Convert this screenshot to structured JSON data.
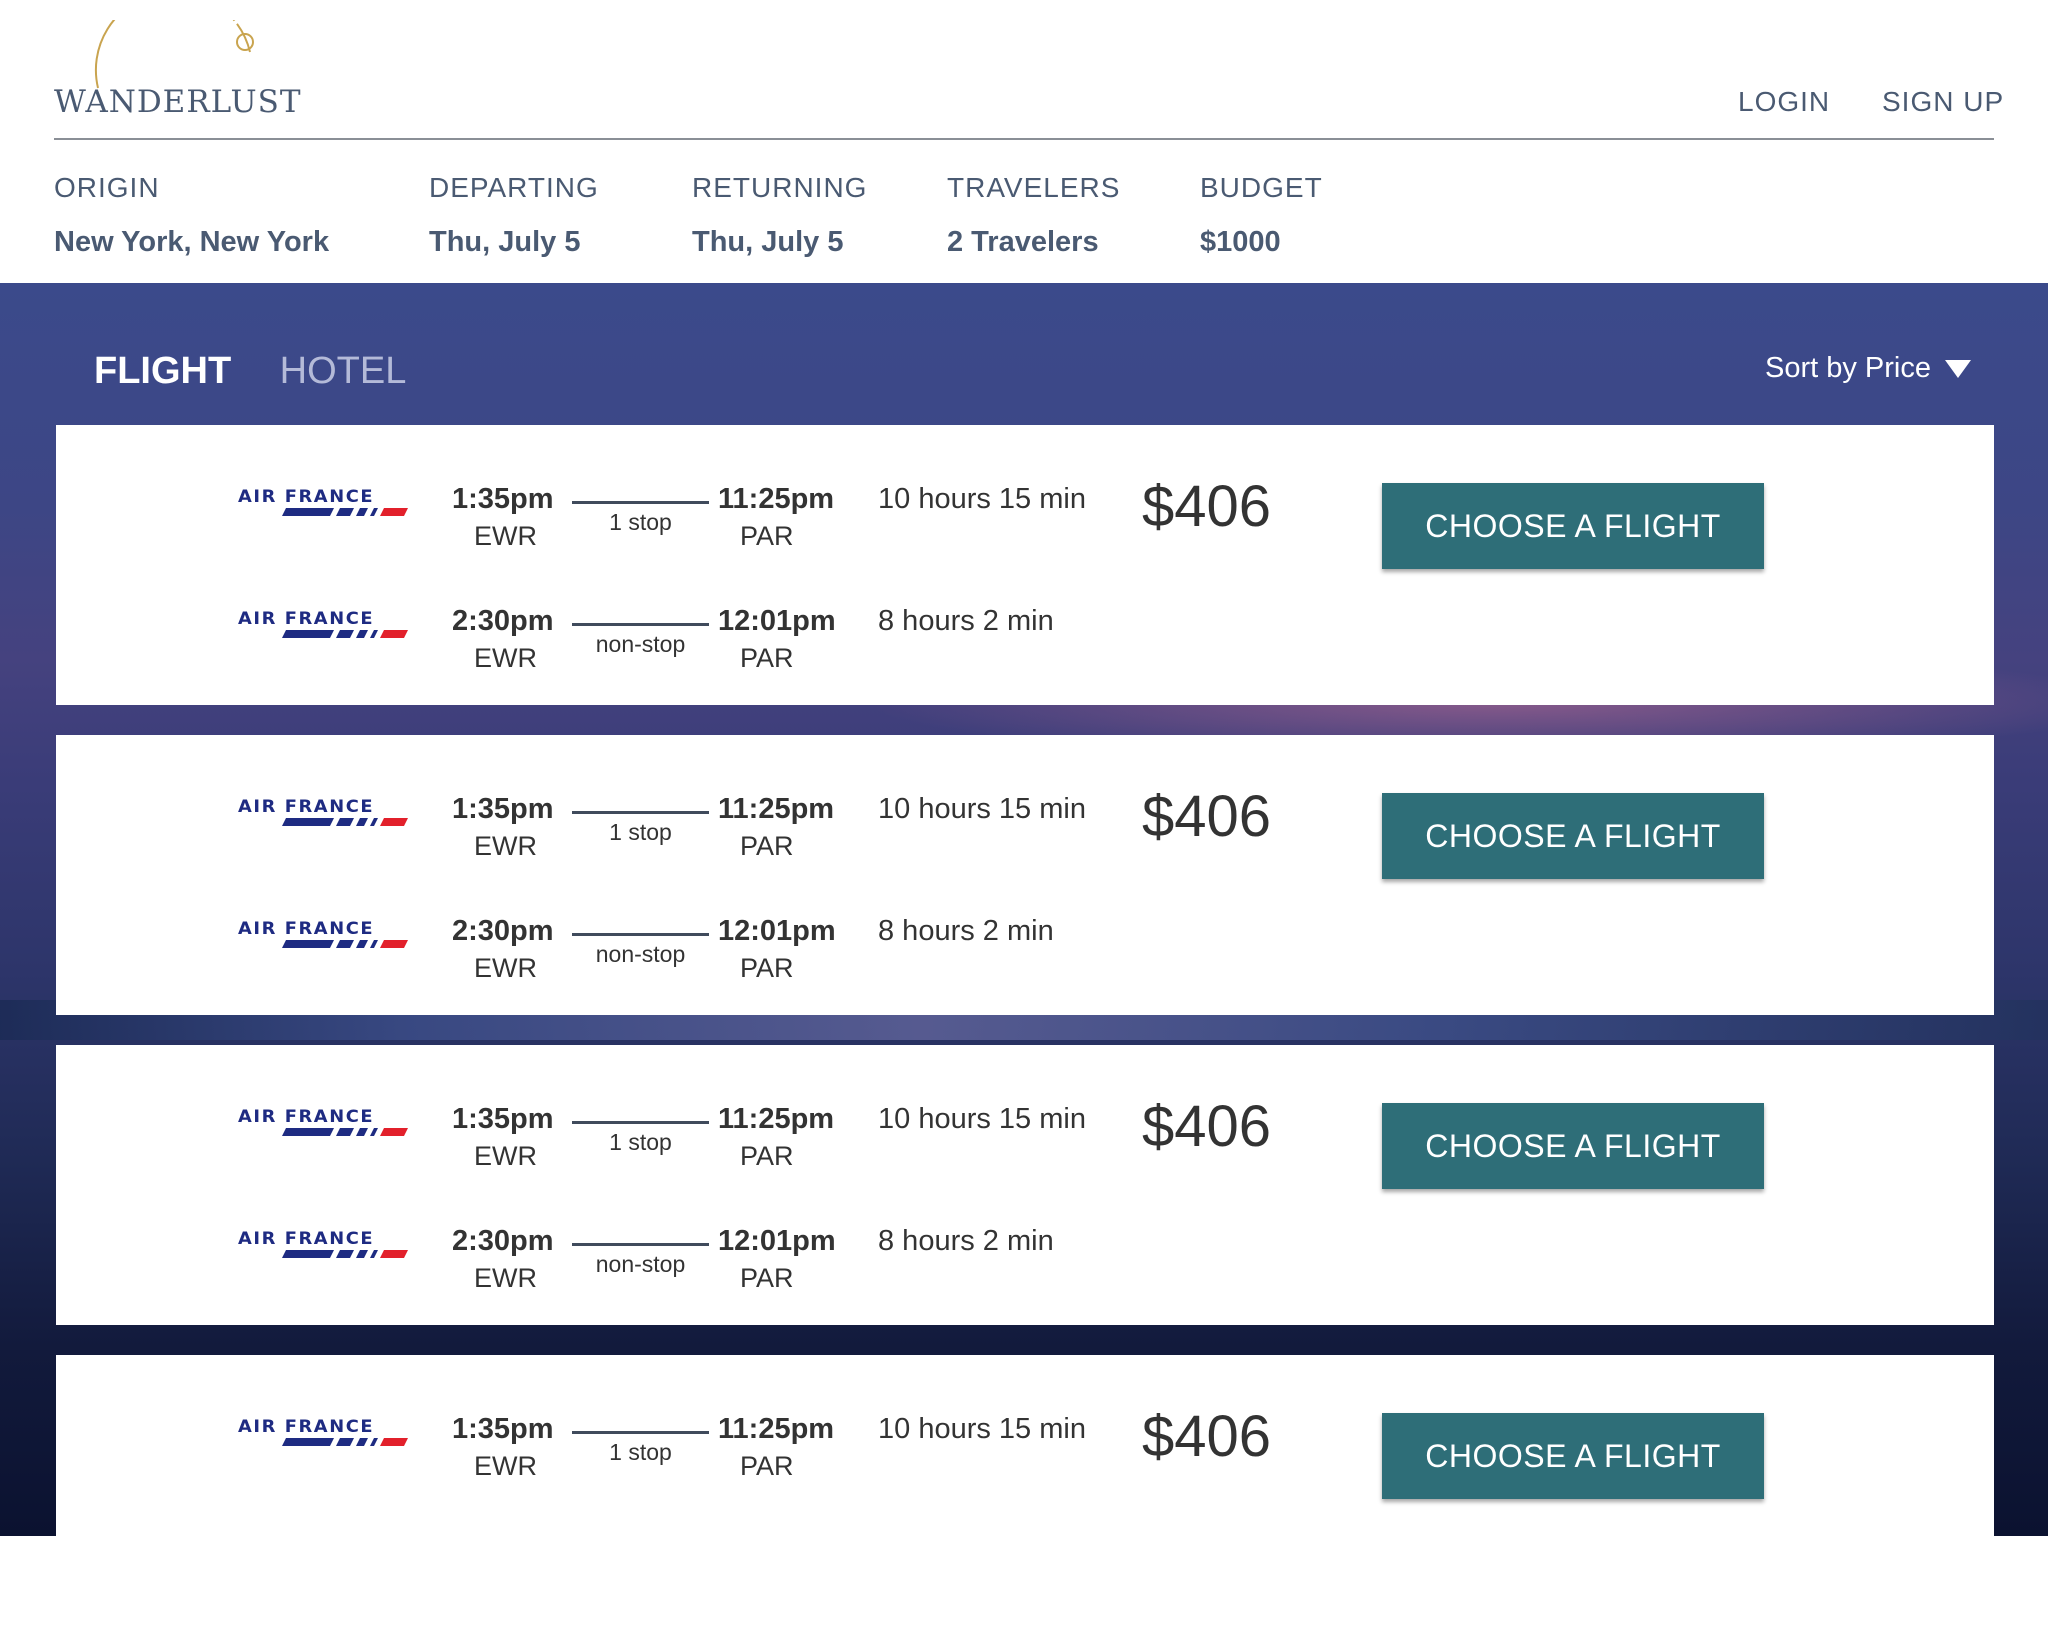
{
  "brand": {
    "name": "WANDERLUST"
  },
  "nav": {
    "login": "LOGIN",
    "signup": "SIGN UP"
  },
  "search": {
    "origin": {
      "label": "ORIGIN",
      "value": "New York, New York"
    },
    "departing": {
      "label": "DEPARTING",
      "value": "Thu, July 5"
    },
    "returning": {
      "label": "RETURNING",
      "value": "Thu, July 5"
    },
    "travelers": {
      "label": "TRAVELERS",
      "value": "2 Travelers"
    },
    "budget": {
      "label": "BUDGET",
      "value": "$1000"
    }
  },
  "tabs": {
    "flight": "FLIGHT",
    "hotel": "HOTEL"
  },
  "sort": {
    "label": "Sort by Price"
  },
  "results": [
    {
      "price": "$406",
      "button": "CHOOSE A FLIGHT",
      "legs": [
        {
          "airline": "AIR FRANCE",
          "dep_time": "1:35pm",
          "dep_airport": "EWR",
          "stops": "1 stop",
          "arr_time": "11:25pm",
          "arr_airport": "PAR",
          "duration": "10 hours 15 min"
        },
        {
          "airline": "AIR FRANCE",
          "dep_time": "2:30pm",
          "dep_airport": "EWR",
          "stops": "non-stop",
          "arr_time": "12:01pm",
          "arr_airport": "PAR",
          "duration": "8 hours 2 min"
        }
      ]
    },
    {
      "price": "$406",
      "button": "CHOOSE A FLIGHT",
      "legs": [
        {
          "airline": "AIR FRANCE",
          "dep_time": "1:35pm",
          "dep_airport": "EWR",
          "stops": "1 stop",
          "arr_time": "11:25pm",
          "arr_airport": "PAR",
          "duration": "10 hours 15 min"
        },
        {
          "airline": "AIR FRANCE",
          "dep_time": "2:30pm",
          "dep_airport": "EWR",
          "stops": "non-stop",
          "arr_time": "12:01pm",
          "arr_airport": "PAR",
          "duration": "8 hours 2 min"
        }
      ]
    },
    {
      "price": "$406",
      "button": "CHOOSE A FLIGHT",
      "legs": [
        {
          "airline": "AIR FRANCE",
          "dep_time": "1:35pm",
          "dep_airport": "EWR",
          "stops": "1 stop",
          "arr_time": "11:25pm",
          "arr_airport": "PAR",
          "duration": "10 hours 15 min"
        },
        {
          "airline": "AIR FRANCE",
          "dep_time": "2:30pm",
          "dep_airport": "EWR",
          "stops": "non-stop",
          "arr_time": "12:01pm",
          "arr_airport": "PAR",
          "duration": "8 hours 2 min"
        }
      ]
    },
    {
      "price": "$406",
      "button": "CHOOSE A FLIGHT",
      "legs": [
        {
          "airline": "AIR FRANCE",
          "dep_time": "1:35pm",
          "dep_airport": "EWR",
          "stops": "1 stop",
          "arr_time": "11:25pm",
          "arr_airport": "PAR",
          "duration": "10 hours 15 min"
        }
      ]
    }
  ]
}
